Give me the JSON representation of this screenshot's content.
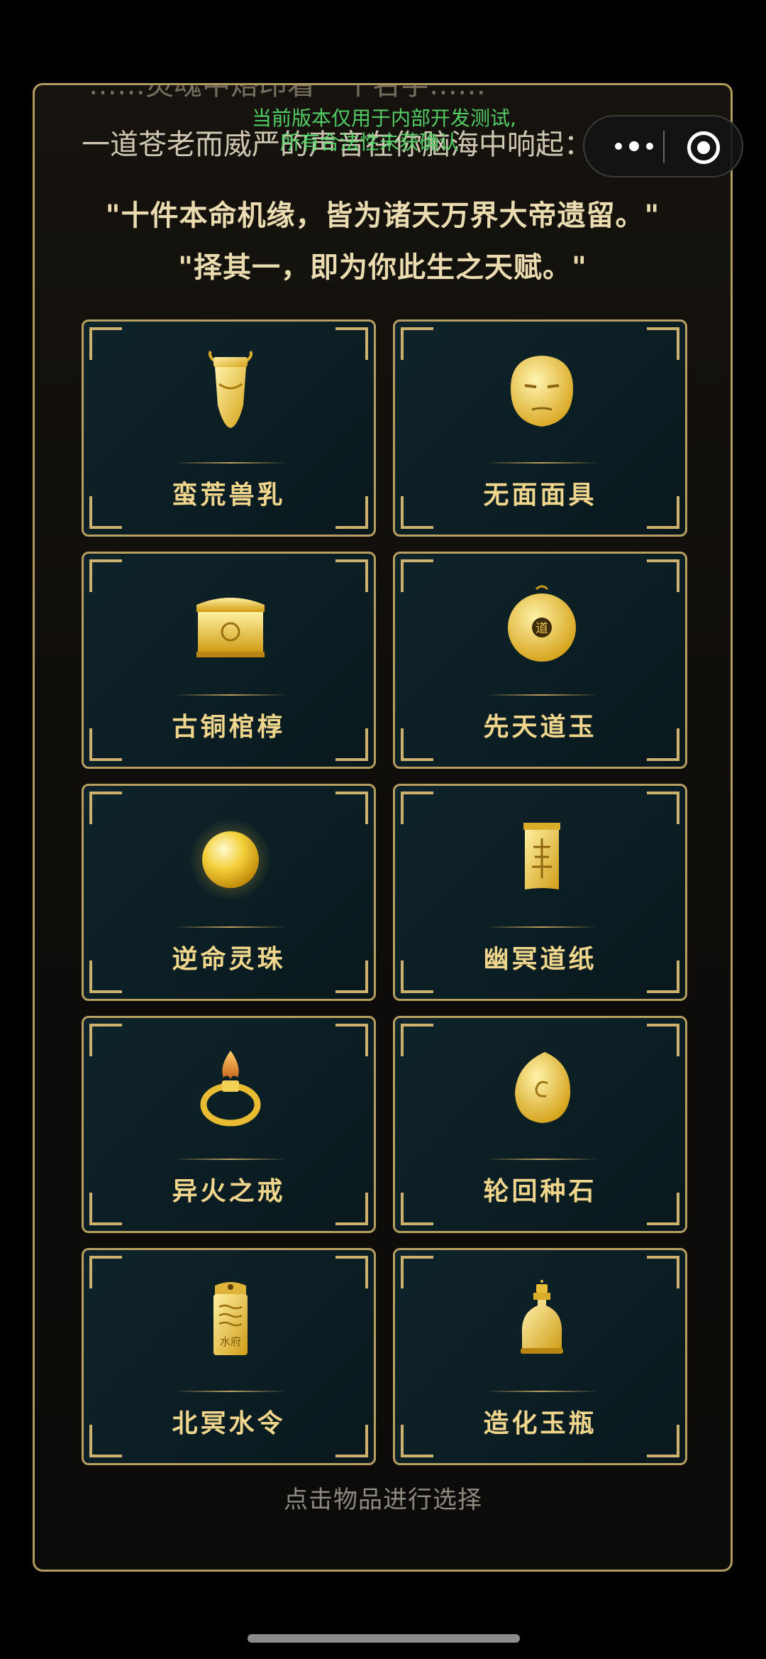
{
  "panel": {
    "partial_top_line": "……灵魂中烙印着一个名字……",
    "voice_line": "一道苍老而威严的声音在你脑海中响起：",
    "quote_1": "\"十件本命机缘，皆为诸天万界大帝遗留。\"",
    "quote_2": "\"择其一，即为你此生之天赋。\""
  },
  "dev_notice": {
    "line1": "当前版本仅用于内部开发测试,",
    "line2": "所有合法性未获确认"
  },
  "capsule": {
    "more_icon": "more-dots-icon",
    "close_icon": "close-target-icon"
  },
  "items": [
    {
      "label": "蛮荒兽乳",
      "icon": "beast-milk-vase-icon"
    },
    {
      "label": "无面面具",
      "icon": "faceless-mask-icon"
    },
    {
      "label": "古铜棺椁",
      "icon": "bronze-coffin-icon"
    },
    {
      "label": "先天道玉",
      "icon": "dao-jade-coin-icon"
    },
    {
      "label": "逆命灵珠",
      "icon": "spirit-pearl-icon"
    },
    {
      "label": "幽冥道纸",
      "icon": "underworld-talisman-icon"
    },
    {
      "label": "异火之戒",
      "icon": "flame-ring-icon"
    },
    {
      "label": "轮回种石",
      "icon": "reincarnation-seed-stone-icon"
    },
    {
      "label": "北冥水令",
      "icon": "water-token-icon"
    },
    {
      "label": "造化玉瓶",
      "icon": "jade-bottle-icon"
    }
  ],
  "icon_texts": {
    "jade_coin_char": "道",
    "water_token_text": "水府"
  },
  "hint": "点击物品进行选择",
  "colors": {
    "gold": "#f0d68c",
    "border": "#b69f60",
    "card_bg": "#0d1f25",
    "notice_green": "#55d66a"
  }
}
